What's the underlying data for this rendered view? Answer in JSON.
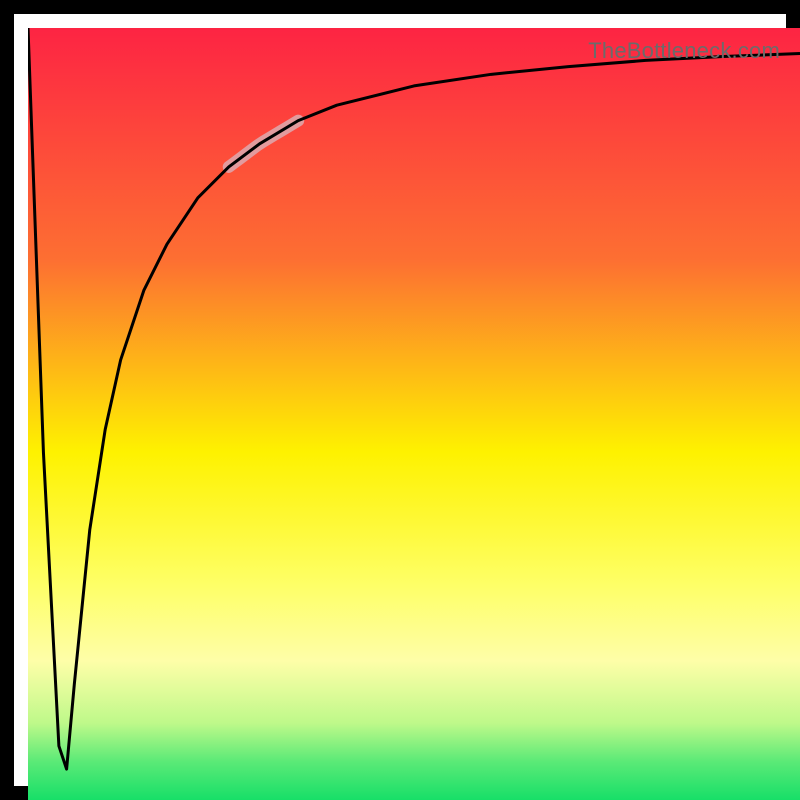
{
  "watermark": "TheBottleneck.com",
  "chart_data": {
    "type": "line",
    "title": "",
    "xlabel": "",
    "ylabel": "",
    "xlim": [
      0,
      100
    ],
    "ylim": [
      0,
      100
    ],
    "grid": false,
    "legend": false,
    "x": [
      0,
      2,
      4,
      5,
      6,
      8,
      10,
      12,
      15,
      18,
      22,
      26,
      30,
      35,
      40,
      50,
      60,
      70,
      80,
      90,
      100
    ],
    "values": [
      100,
      45,
      7,
      4,
      15,
      35,
      48,
      57,
      66,
      72,
      78,
      82,
      85,
      88,
      90,
      92.5,
      94,
      95,
      95.8,
      96.3,
      96.7
    ],
    "highlight_segment": {
      "x_start": 26,
      "x_end": 35,
      "color": "#e29b9e",
      "width": 12
    },
    "background_gradient": {
      "stops": [
        {
          "offset": 0.0,
          "color": "#fd2443"
        },
        {
          "offset": 0.3,
          "color": "#fd6f32"
        },
        {
          "offset": 0.55,
          "color": "#fef200"
        },
        {
          "offset": 0.72,
          "color": "#feff66"
        },
        {
          "offset": 0.82,
          "color": "#fefea8"
        },
        {
          "offset": 0.9,
          "color": "#bff98a"
        },
        {
          "offset": 0.95,
          "color": "#5bea77"
        },
        {
          "offset": 1.0,
          "color": "#17df68"
        }
      ]
    }
  }
}
